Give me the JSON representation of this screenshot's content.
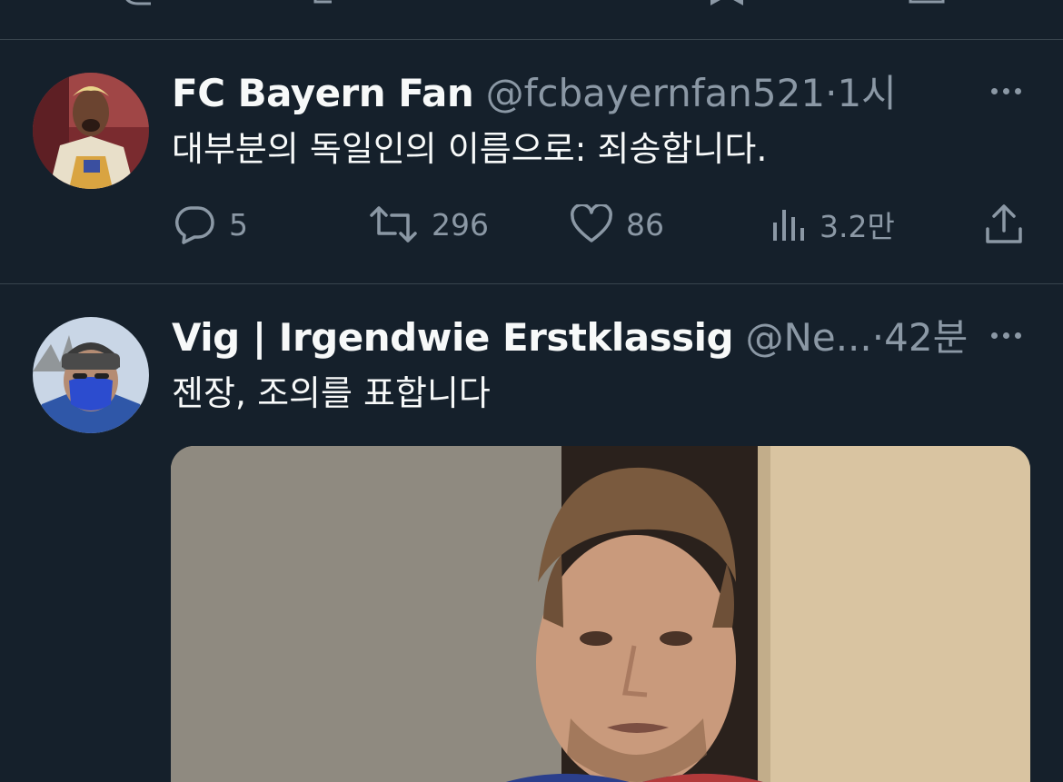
{
  "prev_tweet_actions": {
    "icons": [
      "reply-icon",
      "retweet-icon",
      "like-icon",
      "bookmark-icon",
      "share-icon"
    ]
  },
  "tweets": [
    {
      "name": "FC Bayern Fan",
      "handle": "@fcbayernfan521",
      "separator": "·",
      "time": "1시",
      "text": "대부분의 독일인의 이름으로: 죄송합니다.",
      "avatar_icon": "profile-photo",
      "actions": {
        "replies": "5",
        "retweets": "296",
        "likes": "86",
        "views": "3.2만"
      }
    },
    {
      "name": "Vig | Irgendwie Erstklassig",
      "handle": "@Ne...",
      "separator": "·",
      "time": "42분",
      "text": "젠장, 조의를 표합니다",
      "avatar_icon": "profile-photo",
      "media_icon": "attached-photo"
    }
  ],
  "colors": {
    "background": "#15202b",
    "divider": "#38444d",
    "primary_text": "#f7f9f9",
    "secondary_text": "#8b98a5"
  }
}
